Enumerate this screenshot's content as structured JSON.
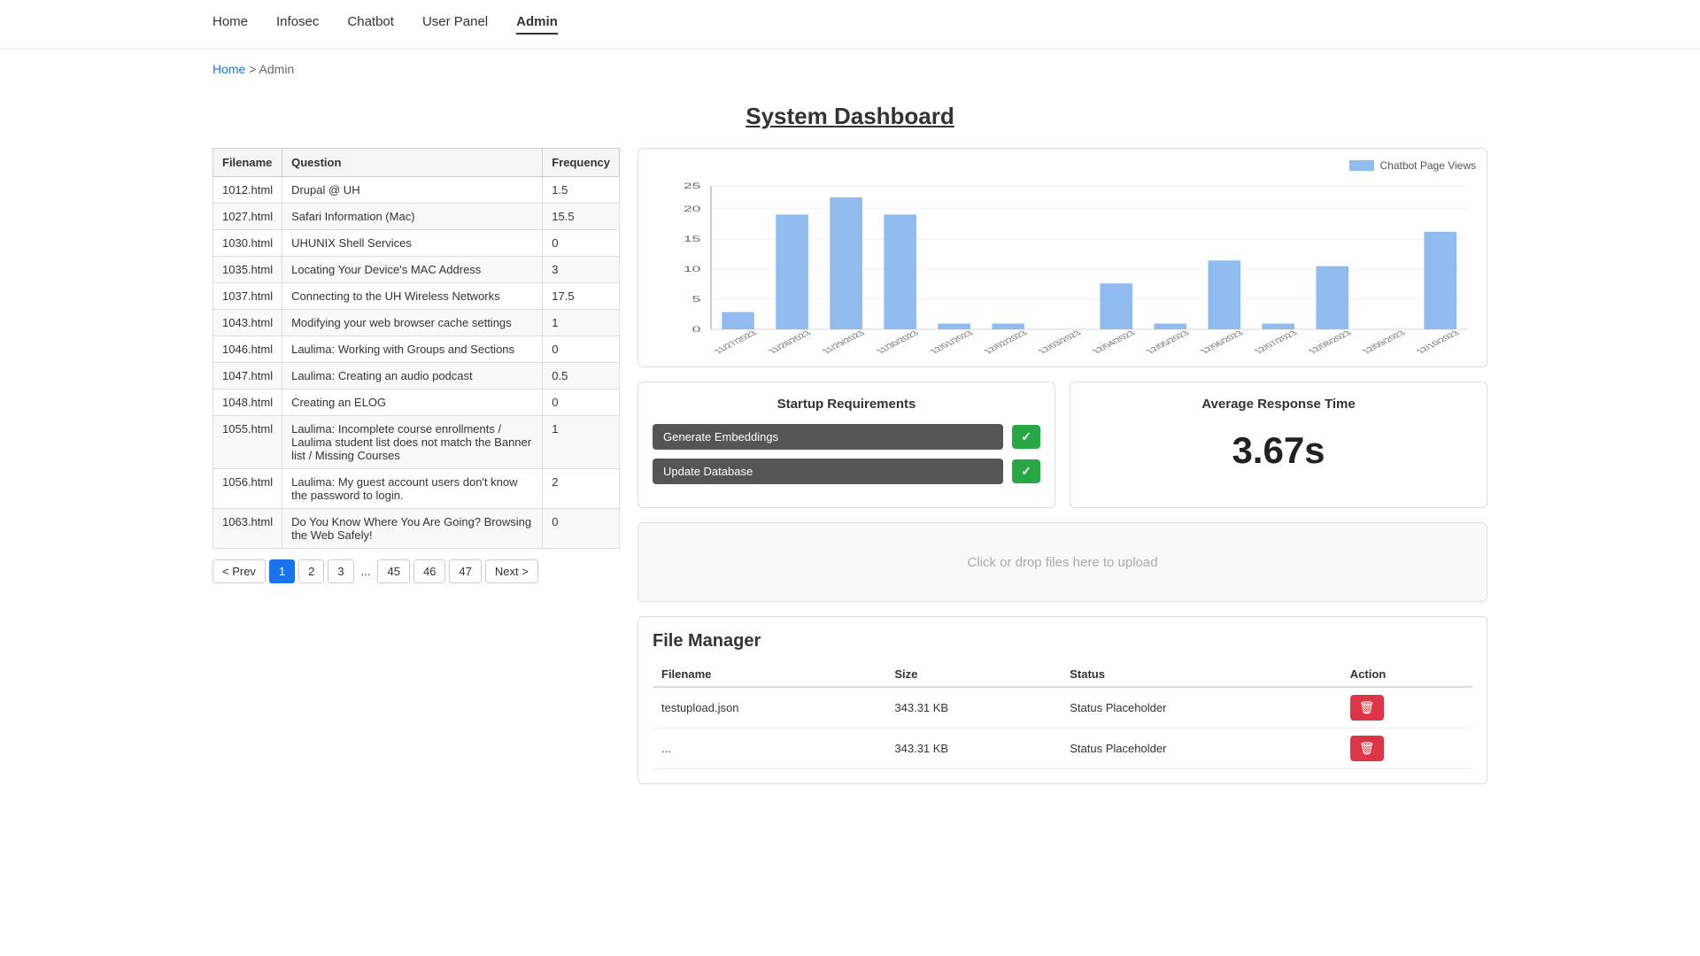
{
  "nav": {
    "items": [
      {
        "label": "Home",
        "active": false
      },
      {
        "label": "Infosec",
        "active": false
      },
      {
        "label": "Chatbot",
        "active": false
      },
      {
        "label": "User Panel",
        "active": false
      },
      {
        "label": "Admin",
        "active": true
      }
    ]
  },
  "breadcrumb": {
    "home_label": "Home",
    "separator": ">",
    "current": "Admin"
  },
  "page_title": "System Dashboard",
  "table": {
    "headers": [
      "Filename",
      "Question",
      "Frequency"
    ],
    "rows": [
      {
        "filename": "1012.html",
        "question": "Drupal @ UH",
        "frequency": "1.5"
      },
      {
        "filename": "1027.html",
        "question": "Safari Information (Mac)",
        "frequency": "15.5"
      },
      {
        "filename": "1030.html",
        "question": "UHUNIX Shell Services",
        "frequency": "0"
      },
      {
        "filename": "1035.html",
        "question": "Locating Your Device's MAC Address",
        "frequency": "3"
      },
      {
        "filename": "1037.html",
        "question": "Connecting to the UH Wireless Networks",
        "frequency": "17.5"
      },
      {
        "filename": "1043.html",
        "question": "Modifying your web browser cache settings",
        "frequency": "1"
      },
      {
        "filename": "1046.html",
        "question": "Laulima: Working with Groups and Sections",
        "frequency": "0"
      },
      {
        "filename": "1047.html",
        "question": "Laulima: Creating an audio podcast",
        "frequency": "0.5"
      },
      {
        "filename": "1048.html",
        "question": "Creating an ELOG",
        "frequency": "0"
      },
      {
        "filename": "1055.html",
        "question": "Laulima: Incomplete course enrollments / Laulima student list does not match the Banner list / Missing Courses",
        "frequency": "1"
      },
      {
        "filename": "1056.html",
        "question": "Laulima: My guest account users don't know the password to login.",
        "frequency": "2"
      },
      {
        "filename": "1063.html",
        "question": "Do You Know Where You Are Going? Browsing the Web Safely!",
        "frequency": "0"
      }
    ]
  },
  "pagination": {
    "prev_label": "< Prev",
    "next_label": "Next >",
    "pages": [
      "1",
      "2",
      "3",
      "...",
      "45",
      "46",
      "47"
    ],
    "active_page": "1"
  },
  "chart": {
    "title": "Chatbot Page Views",
    "legend_label": "Chatbot Page Views",
    "y_labels": [
      "0",
      "5",
      "10",
      "15",
      "20",
      "25"
    ],
    "x_labels": [
      "11/27/2023",
      "11/28/2023",
      "11/29/2023",
      "11/30/2023",
      "12/01/2023",
      "12/02/2023",
      "12/03/2023",
      "12/04/2023",
      "12/05/2023",
      "12/06/2023",
      "12/07/2023",
      "12/08/2023",
      "12/09/2023",
      "12/10/2023"
    ],
    "bars": [
      3,
      20,
      23,
      20,
      1,
      1,
      0,
      8,
      1,
      12,
      1,
      11,
      0,
      17
    ]
  },
  "startup": {
    "title": "Startup Requirements",
    "buttons": [
      {
        "label": "Generate Embeddings",
        "checked": true
      },
      {
        "label": "Update Database",
        "checked": true
      }
    ]
  },
  "avg_response": {
    "title": "Average Response Time",
    "value": "3.67s"
  },
  "upload": {
    "placeholder": "Click or drop files here to upload"
  },
  "file_manager": {
    "title": "File Manager",
    "headers": [
      "Filename",
      "Size",
      "Status",
      "Action"
    ],
    "rows": [
      {
        "filename": "testupload.json",
        "size": "343.31 KB",
        "status": "Status Placeholder"
      },
      {
        "filename": "...",
        "size": "343.31 KB",
        "status": "Status Placeholder"
      }
    ]
  }
}
